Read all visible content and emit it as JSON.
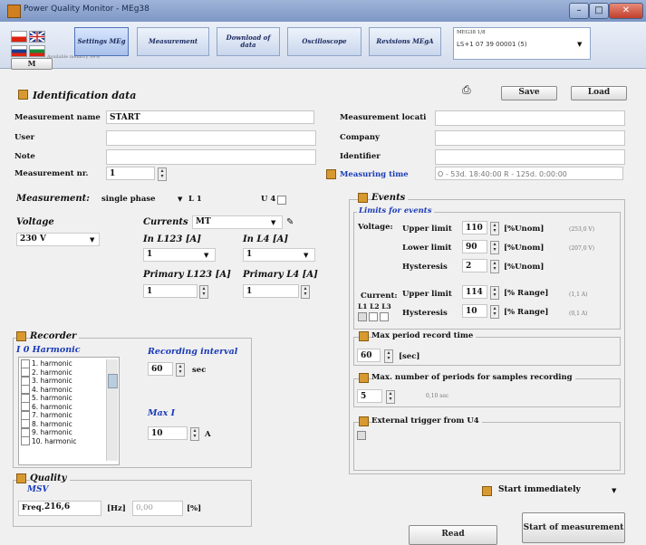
{
  "window": {
    "title": "Power Quality Monitor - MEg38"
  },
  "toolbar": {
    "flags": [
      "cz",
      "gb",
      "sk",
      "bg",
      "hu"
    ],
    "firmware_note": "Available memory 99%",
    "buttons": [
      {
        "label": "Settings MEg",
        "active": true
      },
      {
        "label": "Measurement"
      },
      {
        "label": "Download of data"
      },
      {
        "label": "Oscilloscope"
      },
      {
        "label": "Revisions MEgA"
      }
    ],
    "device": {
      "caption": "MEG38 1/8",
      "value": "LS+1 07 39 00001 (5)"
    },
    "m_button": "M"
  },
  "identification": {
    "title": "Identification data",
    "save": "Save",
    "load": "Load",
    "measurement_name_label": "Measurement name",
    "measurement_name_value": "START",
    "user_label": "User",
    "note_label": "Note",
    "measurement_nr_label": "Measurement nr.",
    "measurement_nr_value": "1",
    "location_label": "Measurement locati",
    "company_label": "Company",
    "identifier_label": "Identifier",
    "measuring_time_label": "Measuring time",
    "measuring_time_value": "O - 53d. 18:40:00 R - 125d. 0:00:00"
  },
  "measurement": {
    "label": "Measurement:",
    "mode": "single phase",
    "phase": "L 1",
    "u4_label": "U 4",
    "voltage_label": "Voltage",
    "voltage_value": "230 V",
    "currents_label": "Currents",
    "currents_value": "MT",
    "in_l123_label": "In L123 [A]",
    "in_l123_value": "1",
    "in_l4_label": "In L4 [A]",
    "in_l4_value": "1",
    "primary_l123_label": "Primary L123 [A]",
    "primary_l123_value": "1",
    "primary_l4_label": "Primary L4 [A]",
    "primary_l4_value": "1"
  },
  "events": {
    "title": "Events",
    "limits_title": "Limits for events",
    "voltage_label": "Voltage:",
    "current_label": "Current:",
    "phases_label": "L1 L2 L3",
    "rows": [
      {
        "label": "Upper limit",
        "value": "110",
        "unit": "[%Unom]",
        "note": "(253,0 V)"
      },
      {
        "label": "Lower limit",
        "value": "90",
        "unit": "[%Unom]",
        "note": "(207,0 V)"
      },
      {
        "label": "Hysteresis",
        "value": "2",
        "unit": "[%Unom]",
        "note": ""
      },
      {
        "label": "Upper limit",
        "value": "114",
        "unit": "[% Range]",
        "note": "(1,1 A)"
      },
      {
        "label": "Hysteresis",
        "value": "10",
        "unit": "[% Range]",
        "note": "(0,1 A)"
      }
    ],
    "max_period_title": "Max period record time",
    "max_period_value": "60",
    "max_period_unit": "[sec]",
    "max_periods_title": "Max. number of periods for samples recording",
    "max_periods_value": "5",
    "max_periods_note": "0,10 sec",
    "ext_trigger_title": "External trigger from U4"
  },
  "recorder": {
    "title": "Recorder",
    "harmonic_label": "I 0 Harmonic",
    "harmonics": [
      "1. harmonic",
      "2. harmonic",
      "3. harmonic",
      "4. harmonic",
      "5. harmonic",
      "6. harmonic",
      "7. harmonic",
      "8. harmonic",
      "9. harmonic",
      "10. harmonic"
    ],
    "interval_label": "Recording interval",
    "interval_value": "60",
    "interval_unit": "sec",
    "maxi_label": "Max I",
    "maxi_value": "10",
    "maxi_unit": "A"
  },
  "quality": {
    "title": "Quality",
    "msv_label": "MSV",
    "freq_label": "Freq.",
    "freq_value": "216,6",
    "freq_unit": "[Hz]",
    "pct_value": "0,00",
    "pct_unit": "[%]"
  },
  "footer": {
    "start_mode": "Start immediately",
    "read": "Read",
    "start": "Start of measurement"
  }
}
